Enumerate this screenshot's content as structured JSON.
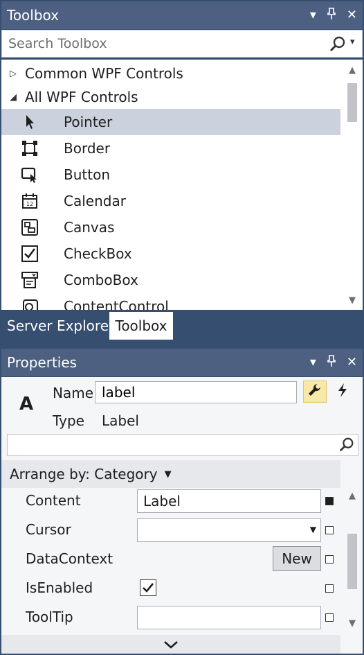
{
  "toolbox": {
    "title": "Toolbox",
    "search_placeholder": "Search Toolbox",
    "categories": [
      {
        "label": "Common WPF Controls",
        "expanded": false
      },
      {
        "label": "All WPF Controls",
        "expanded": true
      }
    ],
    "items": [
      {
        "label": "Pointer",
        "icon": "pointer-icon",
        "selected": true
      },
      {
        "label": "Border",
        "icon": "border-icon"
      },
      {
        "label": "Button",
        "icon": "button-icon"
      },
      {
        "label": "Calendar",
        "icon": "calendar-icon"
      },
      {
        "label": "Canvas",
        "icon": "canvas-icon"
      },
      {
        "label": "CheckBox",
        "icon": "checkbox-icon"
      },
      {
        "label": "ComboBox",
        "icon": "combobox-icon"
      },
      {
        "label": "ContentControl",
        "icon": "contentcontrol-icon"
      }
    ]
  },
  "tabs": {
    "server_explorer": "Server Explorer",
    "toolbox": "Toolbox"
  },
  "properties": {
    "title": "Properties",
    "element_icon_text": "A",
    "name_label": "Name",
    "name_value": "label",
    "type_label": "Type",
    "type_value": "Label",
    "search_placeholder": "",
    "arrange_label": "Arrange by: Category",
    "rows": {
      "content": {
        "name": "Content",
        "value": "Label"
      },
      "cursor": {
        "name": "Cursor",
        "value": ""
      },
      "datacontext": {
        "name": "DataContext",
        "button": "New"
      },
      "isenabled": {
        "name": "IsEnabled",
        "checked": true
      },
      "tooltip": {
        "name": "ToolTip",
        "value": ""
      }
    }
  },
  "colors": {
    "chrome": "#364e6f",
    "titlebar": "#4d6082",
    "selected_row": "#ccd1de",
    "properties_bg": "#f5f6f7",
    "active_toggle": "#f9e9a9"
  }
}
